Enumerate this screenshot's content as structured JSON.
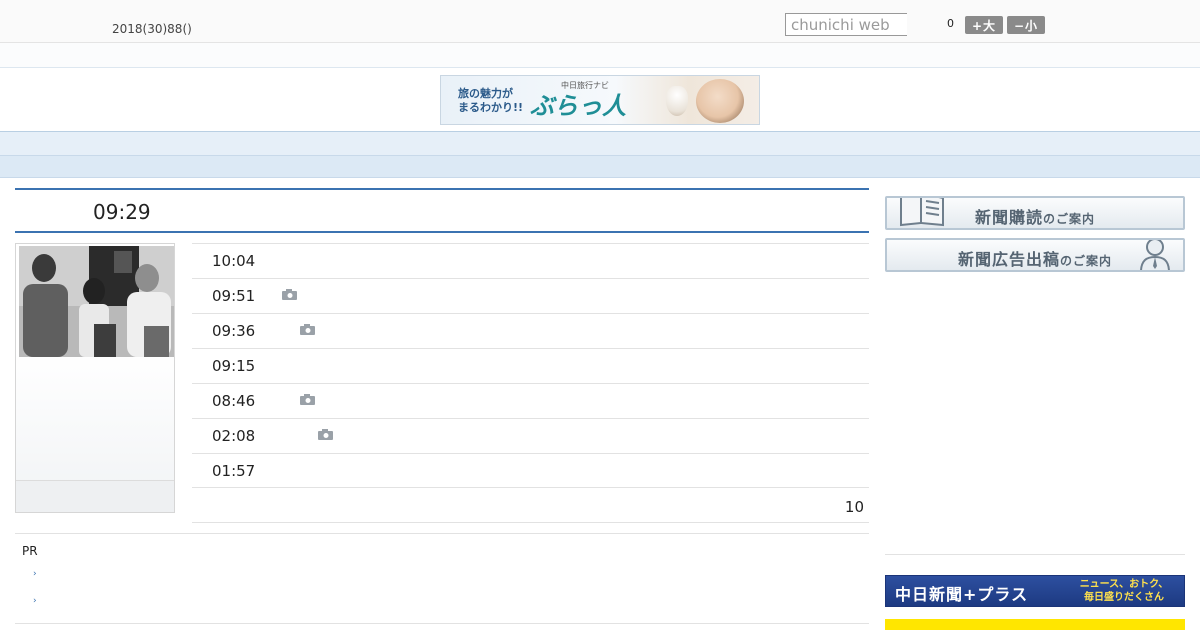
{
  "header": {
    "date": "2018(30)88()",
    "search_placeholder": "chunichi web",
    "count": "0",
    "font_bigger_label": "+大",
    "font_smaller_label": "−小"
  },
  "banner": {
    "tagline_line1": "旅の魅力が",
    "tagline_line2": "まるわかり!!",
    "sub": "中日旅行ナビ",
    "title": "ぶらっ人"
  },
  "nav": {
    "items": [
      "",
      "",
      "",
      "",
      "",
      "",
      "",
      "",
      ""
    ]
  },
  "main": {
    "headline_time": "09:29",
    "news": [
      {
        "time": "10:04",
        "camera": false
      },
      {
        "time": "09:51",
        "camera": true
      },
      {
        "time": "09:36",
        "camera": true
      },
      {
        "time": "09:15",
        "camera": false
      },
      {
        "time": "08:46",
        "camera": true
      },
      {
        "time": "02:08",
        "camera": true
      },
      {
        "time": "01:57",
        "camera": false
      }
    ],
    "more_label": "10",
    "pr_label": "PR",
    "pr_arrow": "›"
  },
  "sidebar": {
    "subscribe_main": "新聞購読",
    "subscribe_sub": "のご案内",
    "advert_main": "新聞広告出稿",
    "advert_sub": "のご案内",
    "plus_main": "中日新聞+プラス",
    "plus_sub_line1": "ニュース、おトク、",
    "plus_sub_line2": "毎日盛りだくさん"
  },
  "colors": {
    "accent_blue": "#3b73b1",
    "nav_bg": "#e6eff8",
    "plus_blue": "#1d3a82",
    "yellow": "#ffe600"
  }
}
